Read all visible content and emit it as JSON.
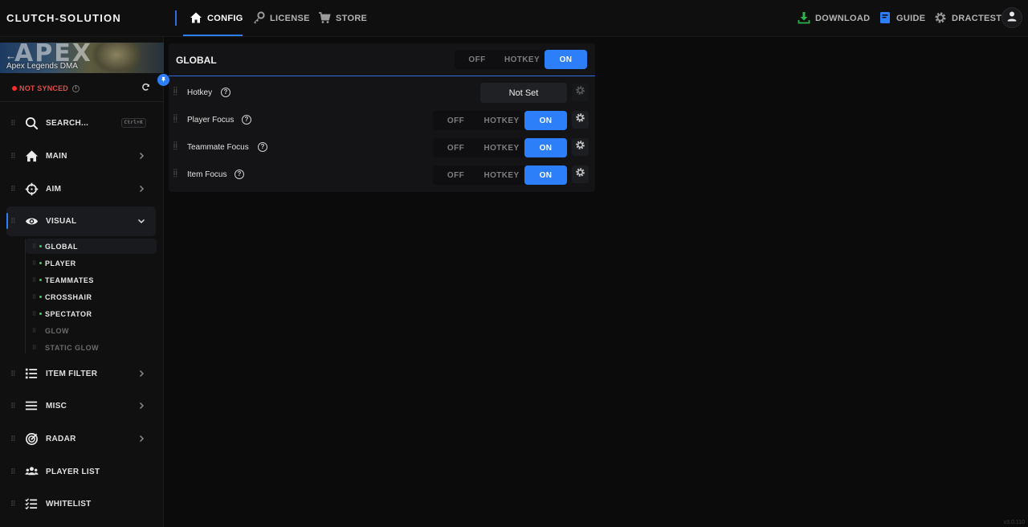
{
  "app": {
    "brand": "CLUTCH-SOLUTION",
    "version": "v3.0.110"
  },
  "topnav": {
    "left": [
      {
        "label": "CONFIG",
        "icon": "home-icon",
        "active": true
      },
      {
        "label": "LICENSE",
        "icon": "key-icon",
        "active": false
      },
      {
        "label": "STORE",
        "icon": "cart-icon",
        "active": false
      }
    ],
    "right": [
      {
        "label": "DOWNLOAD",
        "icon": "download-icon",
        "color": "#2fb34a"
      },
      {
        "label": "GUIDE",
        "icon": "book-icon",
        "color": "#2d7ff9"
      },
      {
        "label": "DRACTEST",
        "icon": "gear-icon",
        "color": "#9a9a9a"
      }
    ]
  },
  "sidebar": {
    "game": {
      "title": "Apex Legends DMA",
      "logo": "APEX"
    },
    "sync": {
      "status": "NOT SYNCED",
      "color": "#ff2a2a"
    },
    "search": {
      "label": "SEARCH...",
      "shortcut": "Ctrl+K"
    },
    "items": [
      {
        "label": "MAIN",
        "icon": "home-icon"
      },
      {
        "label": "AIM",
        "icon": "crosshair-icon"
      },
      {
        "label": "VISUAL",
        "icon": "eye-icon",
        "expanded": true
      },
      {
        "label": "ITEM FILTER",
        "icon": "list-icon"
      },
      {
        "label": "MISC",
        "icon": "menu-icon"
      },
      {
        "label": "RADAR",
        "icon": "radar-icon"
      },
      {
        "label": "PLAYER LIST",
        "icon": "users-icon"
      },
      {
        "label": "WHITELIST",
        "icon": "checklist-icon"
      }
    ],
    "visual_sub": [
      {
        "label": "GLOBAL",
        "selected": true,
        "enabled": true
      },
      {
        "label": "PLAYER",
        "enabled": true
      },
      {
        "label": "TEAMMATES",
        "enabled": true
      },
      {
        "label": "CROSSHAIR",
        "enabled": true
      },
      {
        "label": "SPECTATOR",
        "enabled": true
      },
      {
        "label": "GLOW",
        "enabled": false
      },
      {
        "label": "STATIC GLOW",
        "enabled": false
      }
    ]
  },
  "panel": {
    "title": "GLOBAL",
    "toggle": {
      "off": "OFF",
      "hotkey": "HOTKEY",
      "on": "ON",
      "selected": "ON"
    },
    "rows": [
      {
        "label": "Hotkey",
        "value": "Not Set"
      },
      {
        "label": "Player Focus",
        "off": "OFF",
        "hotkey": "HOTKEY",
        "on": "ON",
        "selected": "ON"
      },
      {
        "label": "Teammate Focus",
        "off": "OFF",
        "hotkey": "HOTKEY",
        "on": "ON",
        "selected": "ON"
      },
      {
        "label": "Item Focus",
        "off": "OFF",
        "hotkey": "HOTKEY",
        "on": "ON",
        "selected": "ON"
      }
    ]
  },
  "colors": {
    "accent": "#2d7ff9",
    "background": "#0b0b0b",
    "panel": "#141416",
    "sync_error": "#ff2a2a",
    "enabled_dot": "#3ecf5c"
  }
}
